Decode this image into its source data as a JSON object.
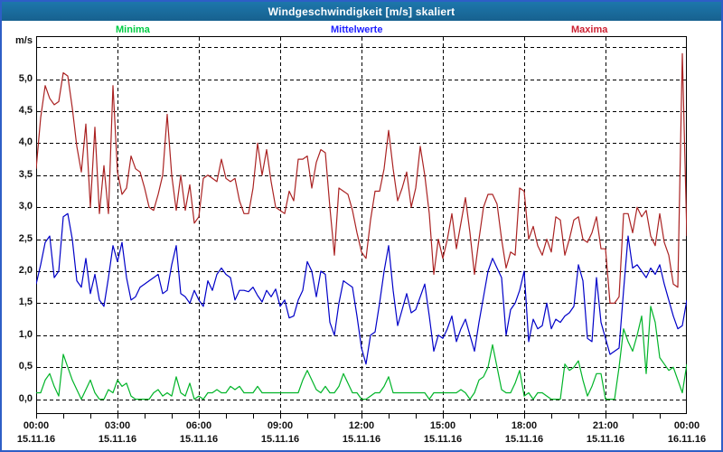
{
  "window": {
    "title": "Windgeschwindigkeit [m/s] skaliert"
  },
  "colors": {
    "frame_border": "#2e5ec6",
    "titlebar_bg": "#1a6b9f",
    "titlebar_text": "#ffffff",
    "plot_border": "#000000",
    "grid": "#000000",
    "minima_label": "#00cc44",
    "mittelwerte_label": "#1f1fff",
    "maxima_label": "#cc2233",
    "minima_line": "#00b428",
    "mittelwerte_line": "#0000c8",
    "maxima_line": "#aa2222"
  },
  "legend": {
    "minima": "Minima",
    "mittelwerte": "Mittelwerte",
    "maxima": "Maxima"
  },
  "chart_data": {
    "type": "line",
    "title": "Windgeschwindigkeit [m/s] skaliert",
    "ylabel": "m/s",
    "grid": "dashed black, horizontal every 0.5 m/s, vertical every 3 h",
    "ylim": [
      0,
      5.5
    ],
    "y_tick_step": 0.5,
    "y_tick_labels": [
      "5,0",
      "4,5",
      "4,0",
      "3,5",
      "3,0",
      "2,5",
      "2,0",
      "1,5",
      "1,0",
      "0,5",
      "0,0"
    ],
    "x_range_hours": [
      0,
      24
    ],
    "x_step_minutes": 10,
    "x_tick_hours": [
      0,
      3,
      6,
      9,
      12,
      15,
      18,
      21,
      24
    ],
    "x_tick_times": [
      "00:00",
      "03:00",
      "06:00",
      "09:00",
      "12:00",
      "15:00",
      "18:00",
      "21:00",
      "00:00"
    ],
    "x_tick_dates": [
      "15.11.16",
      "15.11.16",
      "15.11.16",
      "15.11.16",
      "15.11.16",
      "15.11.16",
      "15.11.16",
      "15.11.16",
      "16.11.16"
    ],
    "series": [
      {
        "name": "Minima",
        "color": "#00b428",
        "values": [
          0.1,
          0.1,
          0.3,
          0.4,
          0.2,
          0.05,
          0.7,
          0.5,
          0.3,
          0.15,
          0.0,
          0.15,
          0.3,
          0.1,
          0.0,
          0.0,
          0.15,
          0.1,
          0.3,
          0.2,
          0.25,
          0.05,
          0.0,
          0.0,
          0.0,
          0.0,
          0.1,
          0.15,
          0.05,
          0.1,
          0.05,
          0.35,
          0.1,
          0.05,
          0.25,
          0.0,
          0.05,
          0.0,
          0.1,
          0.1,
          0.15,
          0.1,
          0.1,
          0.2,
          0.15,
          0.2,
          0.1,
          0.1,
          0.1,
          0.2,
          0.1,
          0.1,
          0.1,
          0.1,
          0.1,
          0.1,
          0.1,
          0.1,
          0.1,
          0.3,
          0.45,
          0.3,
          0.15,
          0.1,
          0.2,
          0.1,
          0.1,
          0.2,
          0.4,
          0.25,
          0.1,
          0.1,
          0.0,
          0.0,
          0.05,
          0.1,
          0.1,
          0.2,
          0.35,
          0.1,
          0.1,
          0.1,
          0.1,
          0.1,
          0.1,
          0.1,
          0.1,
          0.0,
          0.1,
          0.1,
          0.1,
          0.1,
          0.1,
          0.1,
          0.15,
          0.1,
          0.0,
          0.1,
          0.3,
          0.35,
          0.5,
          0.85,
          0.5,
          0.15,
          0.1,
          0.1,
          0.25,
          0.45,
          0.05,
          0.1,
          0.0,
          0.1,
          0.1,
          0.05,
          0.0,
          0.0,
          0.0,
          0.55,
          0.45,
          0.5,
          0.6,
          0.3,
          0.05,
          0.2,
          0.4,
          0.4,
          0.0,
          0.0,
          0.0,
          0.5,
          1.1,
          0.9,
          0.75,
          1.0,
          1.3,
          0.4,
          1.45,
          1.2,
          0.65,
          0.55,
          0.45,
          0.5,
          0.3,
          0.1,
          0.55
        ]
      },
      {
        "name": "Mittelwerte",
        "color": "#0000c8",
        "values": [
          1.8,
          2.1,
          2.45,
          2.55,
          1.9,
          2.0,
          2.85,
          2.9,
          2.5,
          1.85,
          1.75,
          2.2,
          1.65,
          1.95,
          1.55,
          1.45,
          1.9,
          2.4,
          2.15,
          2.45,
          1.9,
          1.55,
          1.6,
          1.75,
          1.8,
          1.85,
          1.9,
          1.95,
          1.65,
          1.7,
          2.1,
          2.4,
          1.65,
          1.6,
          1.5,
          1.7,
          1.55,
          1.45,
          1.85,
          1.7,
          1.95,
          2.05,
          1.95,
          1.9,
          1.55,
          1.7,
          1.7,
          1.68,
          1.75,
          1.62,
          1.52,
          1.7,
          1.6,
          1.72,
          1.45,
          1.55,
          1.27,
          1.3,
          1.55,
          1.7,
          2.15,
          2.0,
          1.6,
          2.0,
          1.95,
          1.2,
          1.0,
          1.5,
          1.85,
          1.8,
          1.75,
          1.3,
          0.8,
          0.55,
          1.0,
          1.05,
          1.5,
          2.0,
          2.4,
          1.7,
          1.15,
          1.4,
          1.65,
          1.35,
          1.4,
          1.6,
          1.8,
          1.3,
          0.75,
          1.0,
          0.95,
          1.1,
          1.3,
          0.9,
          1.1,
          1.25,
          1.0,
          0.75,
          1.2,
          1.6,
          2.0,
          2.2,
          2.05,
          1.9,
          1.0,
          1.4,
          1.5,
          1.7,
          2.0,
          0.9,
          1.25,
          1.1,
          1.15,
          1.5,
          1.1,
          1.25,
          1.2,
          1.3,
          1.35,
          1.45,
          2.1,
          1.85,
          0.95,
          0.9,
          1.9,
          1.2,
          0.95,
          0.7,
          0.75,
          0.8,
          1.7,
          2.55,
          2.05,
          2.1,
          2.0,
          1.9,
          2.05,
          1.95,
          2.1,
          1.8,
          1.55,
          1.3,
          1.1,
          1.15,
          1.55
        ]
      },
      {
        "name": "Maxima",
        "color": "#aa2222",
        "values": [
          3.6,
          4.4,
          4.9,
          4.7,
          4.6,
          4.65,
          5.1,
          5.05,
          4.55,
          3.95,
          3.55,
          4.3,
          3.0,
          4.25,
          2.9,
          3.65,
          2.9,
          4.9,
          3.55,
          3.2,
          3.3,
          3.8,
          3.6,
          3.55,
          3.3,
          3.0,
          2.95,
          3.2,
          3.5,
          4.45,
          3.5,
          2.95,
          3.5,
          2.95,
          3.35,
          2.75,
          2.85,
          3.45,
          3.5,
          3.45,
          3.4,
          3.75,
          3.45,
          3.4,
          3.45,
          3.1,
          2.9,
          2.9,
          3.3,
          4.0,
          3.5,
          3.9,
          3.4,
          3.0,
          2.95,
          2.9,
          3.25,
          3.1,
          3.75,
          3.75,
          3.8,
          3.3,
          3.7,
          3.9,
          3.85,
          3.0,
          2.25,
          3.3,
          3.25,
          3.2,
          2.95,
          2.6,
          2.3,
          2.2,
          2.8,
          3.25,
          3.25,
          3.6,
          4.2,
          3.6,
          3.1,
          3.3,
          3.55,
          3.0,
          3.3,
          3.95,
          3.5,
          2.9,
          1.95,
          2.5,
          2.2,
          2.5,
          2.9,
          2.35,
          2.75,
          3.15,
          2.6,
          1.95,
          2.5,
          3.0,
          3.2,
          3.2,
          3.05,
          2.5,
          2.05,
          2.3,
          2.25,
          3.3,
          3.25,
          2.5,
          2.7,
          2.4,
          2.25,
          2.5,
          2.3,
          2.85,
          2.8,
          2.25,
          2.5,
          2.8,
          2.85,
          2.5,
          2.45,
          2.6,
          2.85,
          2.35,
          2.35,
          1.5,
          1.5,
          1.6,
          2.9,
          2.9,
          2.6,
          3.0,
          2.85,
          2.95,
          2.55,
          2.4,
          2.9,
          2.45,
          2.25,
          1.8,
          1.75,
          5.4,
          2.55
        ]
      }
    ]
  }
}
